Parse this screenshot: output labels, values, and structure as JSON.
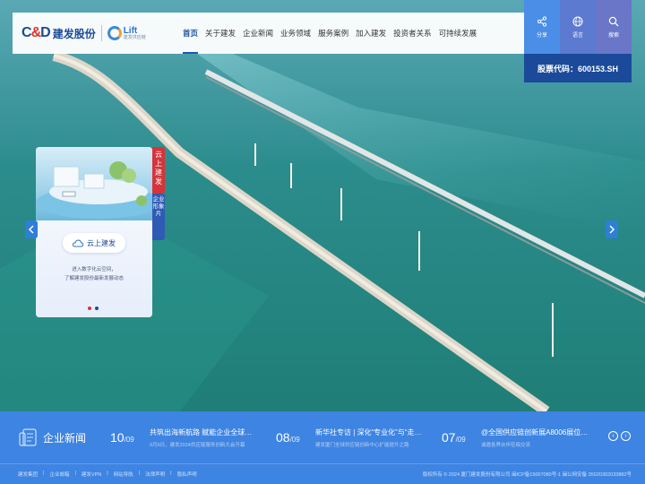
{
  "brand": {
    "logo_en": "C&D",
    "logo_cn": "建发股份",
    "lift_name": "Lift",
    "lift_sub": "建发供应链"
  },
  "nav": {
    "items": [
      {
        "label": "首页",
        "active": true
      },
      {
        "label": "关于建发",
        "active": false
      },
      {
        "label": "企业新闻",
        "active": false
      },
      {
        "label": "业务领域",
        "active": false
      },
      {
        "label": "服务案例",
        "active": false
      },
      {
        "label": "加入建发",
        "active": false
      },
      {
        "label": "投资者关系",
        "active": false
      },
      {
        "label": "可持续发展",
        "active": false
      }
    ]
  },
  "tools": {
    "share": "分享",
    "lang": "语言",
    "search": "搜索"
  },
  "stock": {
    "label": "股票代码：600153.SH"
  },
  "card": {
    "pill": "云上建发",
    "desc_line1": "进入数字化云空间，",
    "desc_line2": "了解建发股份最新发展动态",
    "tab_red": "云上建发",
    "tab_blue": "企业形象片",
    "dot_colors": [
      "#d6343a",
      "#1b4a9a"
    ]
  },
  "news": {
    "title": "企业新闻",
    "items": [
      {
        "day": "10",
        "month": "/09",
        "headline": "共筑出海新航路 赋能企业全球化…",
        "summary": "9月9日，建发2024供应链服务创新大会开幕"
      },
      {
        "day": "08",
        "month": "/09",
        "headline": "新华社专访 | 深化“专业化”与“走…",
        "summary": "建发厦门全球供应链创新中心扩能提升之路"
      },
      {
        "day": "07",
        "month": "/09",
        "headline": "@全国供应链创新展A8006展位…",
        "summary": "诚邀各界伙伴莅临交流"
      }
    ],
    "prev": "‹",
    "next": "›"
  },
  "footer": {
    "links": [
      "建发集团",
      "企业邮箱",
      "建发VPN",
      "网站导航",
      "法律声明",
      "隐私声明"
    ],
    "copyright": "版权所有 © 2024 厦门建发股份有限公司 闽ICP备15007080号-1 闽公网安备 35020302033882号"
  },
  "colors": {
    "primary": "#1b4a9a",
    "accent": "#3e84e2",
    "red": "#d6343a"
  }
}
